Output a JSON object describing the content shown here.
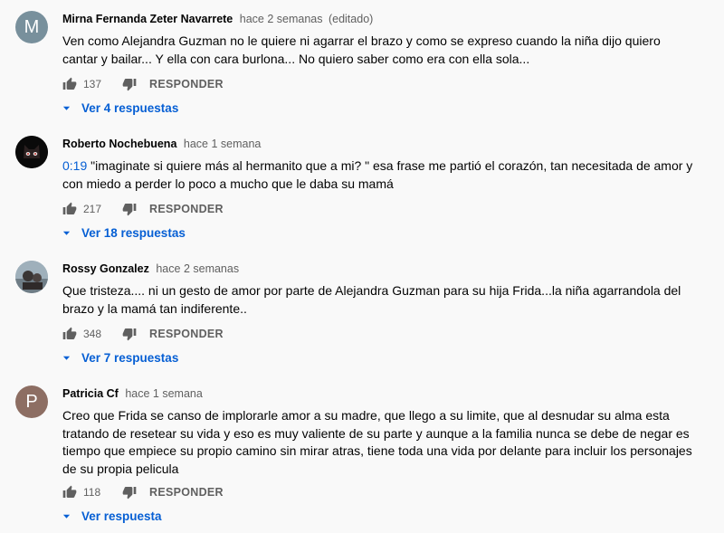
{
  "comments": [
    {
      "author": "Mirna Fernanda Zeter Navarrete",
      "time": "hace 2 semanas",
      "edited": "(editado)",
      "avatar_letter": "M",
      "avatar_color": "#78909c",
      "text": "Ven como Alejandra Guzman no le quiere ni agarrar el brazo y como se expreso cuando la niña dijo quiero  cantar y bailar... Y ella con cara burlona... No quiero saber como era con ella sola...",
      "likes": "137",
      "reply_label": "RESPONDER",
      "view_replies": "Ver 4 respuestas"
    },
    {
      "author": "Roberto Nochebuena",
      "time": "hace 1 semana",
      "timestamp": "0:19",
      "text": "\"imaginate si quiere más al hermanito que a mi? \" esa frase me partió el corazón, tan necesitada de amor y con miedo a perder lo poco a mucho que le daba su mamá",
      "likes": "217",
      "reply_label": "RESPONDER",
      "view_replies": "Ver 18 respuestas"
    },
    {
      "author": "Rossy Gonzalez",
      "time": "hace 2 semanas",
      "text": "Que tristeza.... ni un gesto de amor por parte de Alejandra Guzman para su hija Frida...la niña agarrandola del brazo y la mamá tan indiferente..",
      "likes": "348",
      "reply_label": "RESPONDER",
      "view_replies": "Ver 7 respuestas"
    },
    {
      "author": "Patricia Cf",
      "time": "hace 1 semana",
      "avatar_letter": "P",
      "avatar_color": "#8d6e63",
      "text": "Creo que Frida se canso de implorarle amor a su madre, que llego a su limite, que al desnudar su alma esta tratando de resetear su vida y eso es muy valiente de su parte y aunque a la familia nunca se debe de negar es tiempo que empiece su propio camino sin mirar atras, tiene toda una vida por delante para incluir los personajes de su propia pelicula",
      "likes": "118",
      "reply_label": "RESPONDER",
      "view_replies": "Ver respuesta"
    }
  ],
  "colors": {
    "link": "#065fd4",
    "meta": "#606060",
    "text": "#030303",
    "background": "#f9f9f9"
  },
  "icons": {
    "like": "thumb-up-icon",
    "dislike": "thumb-down-icon",
    "expand": "caret-down-icon"
  }
}
